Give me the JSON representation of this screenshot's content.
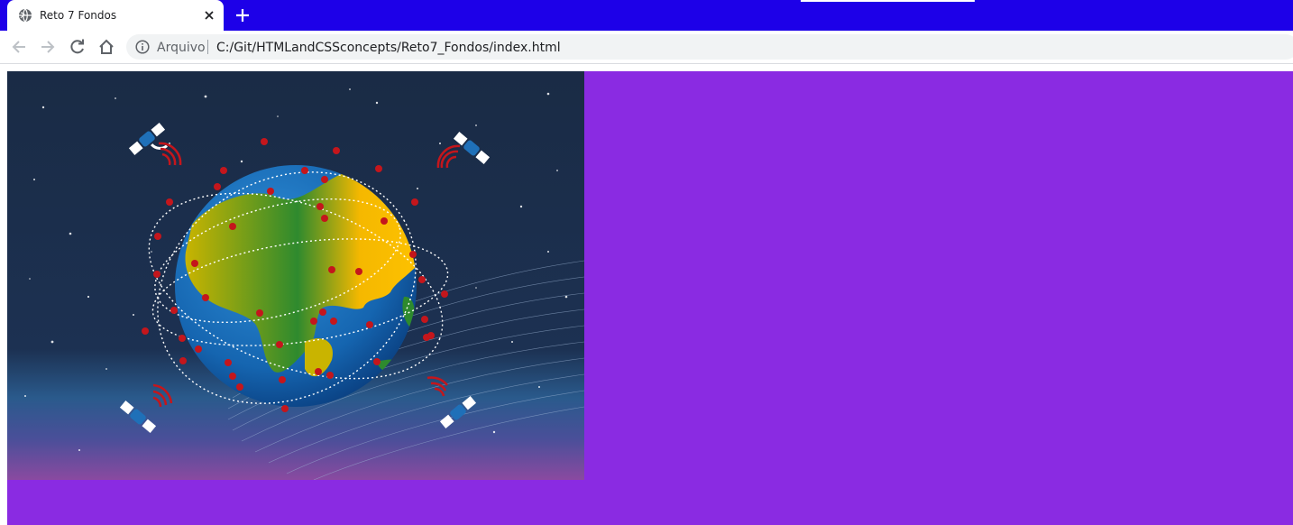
{
  "browser": {
    "tab": {
      "title": "Reto 7 Fondos",
      "favicon": "globe-icon"
    },
    "toolbar": {
      "back_icon": "arrow-left-icon",
      "forward_icon": "arrow-right-icon",
      "reload_icon": "reload-icon",
      "home_icon": "home-icon"
    },
    "omnibox": {
      "scheme_label": "Arquivo",
      "url": "C:/Git/HTMLandCSSconcepts/Reto7_Fondos/index.html"
    }
  },
  "page": {
    "background_color": "#8a2be2",
    "image": "earth-satellites-illustration"
  },
  "colors": {
    "tabstrip": "#1d00e8",
    "page_background": "#8a2be2",
    "space": "#1a2b45",
    "heart": "#c4161c"
  }
}
